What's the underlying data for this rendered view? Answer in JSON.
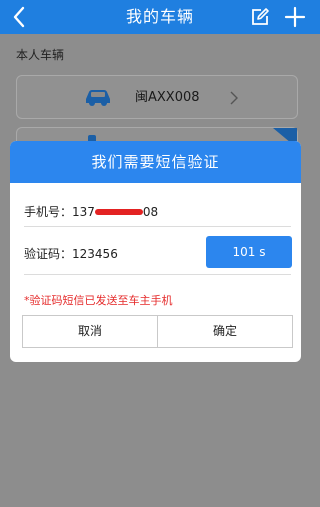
{
  "header": {
    "title": "我的车辆"
  },
  "section": {
    "label": "本人车辆"
  },
  "vehicles": [
    {
      "plate": "闽AXX008"
    }
  ],
  "dialog": {
    "title": "我们需要短信验证",
    "phone_label": "手机号：",
    "phone_prefix": "137",
    "phone_suffix": "08",
    "code_label": "验证码：",
    "code_value": "123456",
    "countdown": "101 s",
    "hint": "*验证码短信已发送至车主手机",
    "cancel_label": "取消",
    "confirm_label": "确定"
  },
  "colors": {
    "brand_blue": "#1f7fe0",
    "dialog_blue": "#2c86ee",
    "hint_red": "#e52b2b"
  }
}
